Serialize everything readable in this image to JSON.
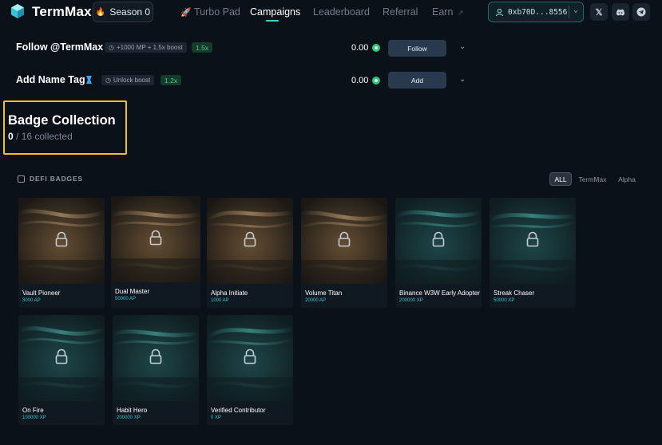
{
  "nav": {
    "brand": "TermMax",
    "season": "Season 0",
    "links": [
      "Turbo Pad",
      "Campaigns",
      "Leaderboard",
      "Referral",
      "Earn"
    ],
    "active_link": "Campaigns",
    "wallet": "0xb70D...8556",
    "social_icons": [
      "x-icon",
      "discord-icon",
      "telegram-icon"
    ],
    "accent_color": "#3ad3c8"
  },
  "tasks": [
    {
      "title": "Follow @TermMax",
      "tag": "+1000 MP + 1.5x boost",
      "multiplier": "1.5x",
      "amount": "0.00",
      "button": "Follow"
    },
    {
      "title": "Add Name Tag",
      "tag": "Unlock boost",
      "multiplier": "1.2x",
      "amount": "0.00",
      "button": "Add"
    }
  ],
  "collection": {
    "title": "Badge Collection",
    "collected": "0",
    "total_text": "/ 16  collected",
    "highlight_color": "#f2c21b"
  },
  "section": {
    "label": "DEFI BADGES",
    "filters": [
      "ALL",
      "TermMax",
      "Alpha"
    ],
    "active_filter": "ALL"
  },
  "badges": [
    {
      "name": "Vault Pioneer",
      "xp": "3000 AP",
      "art": "gold"
    },
    {
      "name": "Dual Master",
      "xp": "50000 AP",
      "art": "gold"
    },
    {
      "name": "Alpha Initiate",
      "xp": "1000 AP",
      "art": "gold"
    },
    {
      "name": "Volume Titan",
      "xp": "20000 AP",
      "art": "gold"
    },
    {
      "name": "Binance W3W Early Adopter",
      "xp": "200000 XP",
      "art": "teal"
    },
    {
      "name": "Streak Chaser",
      "xp": "50000 XP",
      "art": "teal"
    },
    {
      "name": "On Fire",
      "xp": "100000 XP",
      "art": "teal"
    },
    {
      "name": "Habit Hero",
      "xp": "200000 XP",
      "art": "teal"
    },
    {
      "name": "Verified Contributor",
      "xp": "0 XP",
      "art": "teal"
    }
  ]
}
